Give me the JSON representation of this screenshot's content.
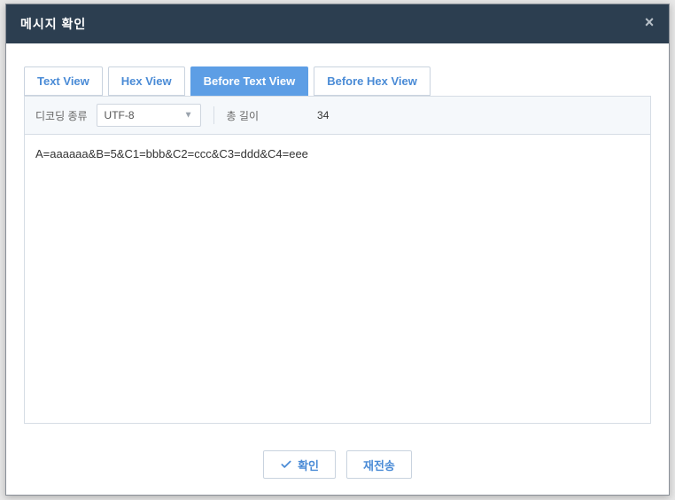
{
  "header": {
    "title": "메시지 확인",
    "close_glyph": "×"
  },
  "tabs": [
    {
      "label": "Text View",
      "active": false
    },
    {
      "label": "Hex View",
      "active": false
    },
    {
      "label": "Before Text View",
      "active": true
    },
    {
      "label": "Before Hex View",
      "active": false
    }
  ],
  "toolbar": {
    "decoding_label": "디코딩 종류",
    "decoding_value": "UTF-8",
    "length_label": "총 길이",
    "length_value": "34"
  },
  "content": {
    "text": "A=aaaaaa&B=5&C1=bbb&C2=ccc&C3=ddd&C4=eee"
  },
  "footer": {
    "confirm_label": "확인",
    "resend_label": "재전송"
  }
}
